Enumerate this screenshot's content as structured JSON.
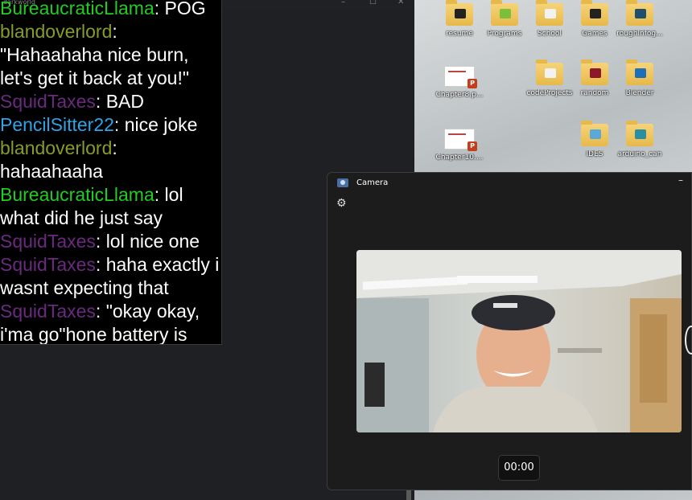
{
  "background_window": {
    "title": "darkworld",
    "controls": [
      "–",
      "☐",
      "✕"
    ]
  },
  "chat": {
    "messages": [
      {
        "user": "BureaucraticLlama",
        "color": "#22cc22",
        "text": ": POG"
      },
      {
        "user": "blandoverlord",
        "color": "#8a9a2a",
        "text": ": \"Hahaahaha nice burn, let's get it back at you!\""
      },
      {
        "user": "SquidTaxes",
        "color": "#6a2a80",
        "text": ": BAD"
      },
      {
        "user": "PencilSitter22",
        "color": "#2fa3e6",
        "text": ": nice joke"
      },
      {
        "user": "blandoverlord",
        "color": "#8a9a2a",
        "text": ": hahaahaaha"
      },
      {
        "user": "BureaucraticLlama",
        "color": "#22cc22",
        "text": ": lol what did he just say"
      },
      {
        "user": "SquidTaxes",
        "color": "#6a2a80",
        "text": ": lol nice one"
      },
      {
        "user": "SquidTaxes",
        "color": "#6a2a80",
        "text": ": haha exactly i wasnt expecting that"
      },
      {
        "user": "SquidTaxes",
        "color": "#6a2a80",
        "text": ": \"okay okay, i'ma go\"hone battery is"
      }
    ]
  },
  "desktop": {
    "icons": [
      {
        "name": "resume",
        "kind": "folder",
        "badge_color": "#222222"
      },
      {
        "name": "Programs",
        "kind": "folder",
        "badge_color": "#7bbf3a"
      },
      {
        "name": "School",
        "kind": "folder",
        "badge_color": "#f2f2f2"
      },
      {
        "name": "Games",
        "kind": "folder",
        "badge_color": "#222222"
      },
      {
        "name": "roughInfog...",
        "kind": "folder",
        "badge_color": "#1f4f6e"
      },
      {
        "name": "Chapter8.p...",
        "kind": "slide"
      },
      {
        "name": "codeProjects",
        "kind": "folder",
        "badge_color": "#f2f2f2"
      },
      {
        "name": "random",
        "kind": "folder",
        "badge_color": "#8a1a2a"
      },
      {
        "name": "Blender",
        "kind": "folder",
        "badge_color": "#1f6fb8"
      },
      {
        "name": "Chapter10....",
        "kind": "slide"
      },
      {
        "name": "IDES",
        "kind": "folder",
        "badge_color": "#5aa9d6"
      },
      {
        "name": "arduino_can",
        "kind": "folder",
        "badge_color": "#2a8fa0"
      }
    ]
  },
  "camera": {
    "title": "Camera",
    "minimize": "–",
    "settings_icon": "gear-icon",
    "timer": "00:00"
  }
}
